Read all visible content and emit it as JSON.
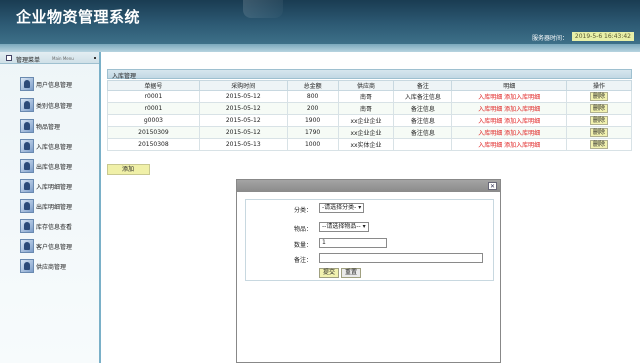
{
  "app": {
    "title": "企业物资管理系统",
    "server_time_label": "服务器时间：",
    "server_time": "2019-5-6 16:43:42"
  },
  "sidebar": {
    "header": "管理菜单",
    "header_sub": "Main Menu",
    "items": [
      {
        "label": "用户信息管理",
        "icon": "user-icon"
      },
      {
        "label": "类别信息管理",
        "icon": "category-icon"
      },
      {
        "label": "物品管理",
        "icon": "goods-icon"
      },
      {
        "label": "入库信息管理",
        "icon": "inbound-icon"
      },
      {
        "label": "出库信息管理",
        "icon": "outbound-icon"
      },
      {
        "label": "入库明细管理",
        "icon": "inbound-detail-icon"
      },
      {
        "label": "出库明细管理",
        "icon": "outbound-detail-icon"
      },
      {
        "label": "库存信息查看",
        "icon": "stock-icon"
      },
      {
        "label": "客户信息管理",
        "icon": "customer-icon"
      },
      {
        "label": "供应商管理",
        "icon": "supplier-icon"
      }
    ]
  },
  "main": {
    "section_title": "入库管理",
    "columns": [
      "单据号",
      "采购时间",
      "总金额",
      "供应商",
      "备注",
      "明细",
      "操作"
    ],
    "rows": [
      {
        "id": "r0001",
        "date": "2015-05-12",
        "amount": "800",
        "supplier": "南哥",
        "remark": "入库备注信息",
        "detail1": "入库明细",
        "detail2": "添加入库明细",
        "action": "删除"
      },
      {
        "id": "r0001",
        "date": "2015-05-12",
        "amount": "200",
        "supplier": "南哥",
        "remark": "备注信息",
        "detail1": "入库明细",
        "detail2": "添加入库明细",
        "action": "删除"
      },
      {
        "id": "g0003",
        "date": "2015-05-12",
        "amount": "1900",
        "supplier": "xx企业企业",
        "remark": "备注信息",
        "detail1": "入库明细",
        "detail2": "添加入库明细",
        "action": "删除"
      },
      {
        "id": "20150309",
        "date": "2015-05-12",
        "amount": "1790",
        "supplier": "xx企业企业",
        "remark": "备注信息",
        "detail1": "入库明细",
        "detail2": "添加入库明细",
        "action": "删除"
      },
      {
        "id": "20150308",
        "date": "2015-05-13",
        "amount": "1000",
        "supplier": "xx实体企业",
        "remark": "",
        "detail1": "入库明细",
        "detail2": "添加入库明细",
        "action": "删除"
      }
    ],
    "add_label": "添加"
  },
  "dialog": {
    "close_glyph": "✕",
    "fields": {
      "category_label": "分类：",
      "category_value": "-请选择分类-",
      "item_label": "物品：",
      "item_value": "--请选择物品--",
      "qty_label": "数量：",
      "qty_value": "1",
      "remark_label": "备注：",
      "remark_value": ""
    },
    "submit_label": "提交",
    "reset_label": "重置"
  }
}
